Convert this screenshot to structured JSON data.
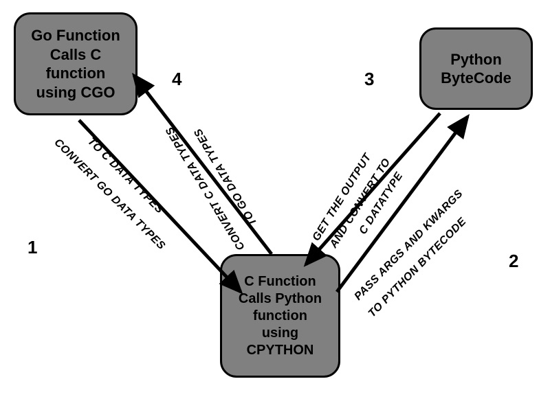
{
  "nodes": {
    "go": {
      "line1": "Go Function",
      "line2": "Calls C",
      "line3": "function",
      "line4": "using CGO"
    },
    "c": {
      "line1": "C Function",
      "line2": "Calls Python",
      "line3": "function",
      "line4": "using",
      "line5": "CPYTHON"
    },
    "py": {
      "line1": "Python",
      "line2": "ByteCode"
    }
  },
  "edges": {
    "one": {
      "l1": "CONVERT GO DATA TYPES",
      "l2": "TO C DATA TYPES"
    },
    "two": {
      "l1": "PASS ARGS AND KWARGS",
      "l2": "TO PYTHON BYTECODE"
    },
    "three": {
      "l1": "GET THE OUTPUT",
      "l2": "AND CONVERT TO",
      "l3": "C DATATYPE"
    },
    "four": {
      "l1": "CONVERT C DATA TYPES",
      "l2": "TO GO DATA TYPES"
    }
  },
  "steps": {
    "s1": "1",
    "s2": "2",
    "s3": "3",
    "s4": "4"
  },
  "colors": {
    "node_fill": "#808080",
    "stroke": "#000000"
  }
}
